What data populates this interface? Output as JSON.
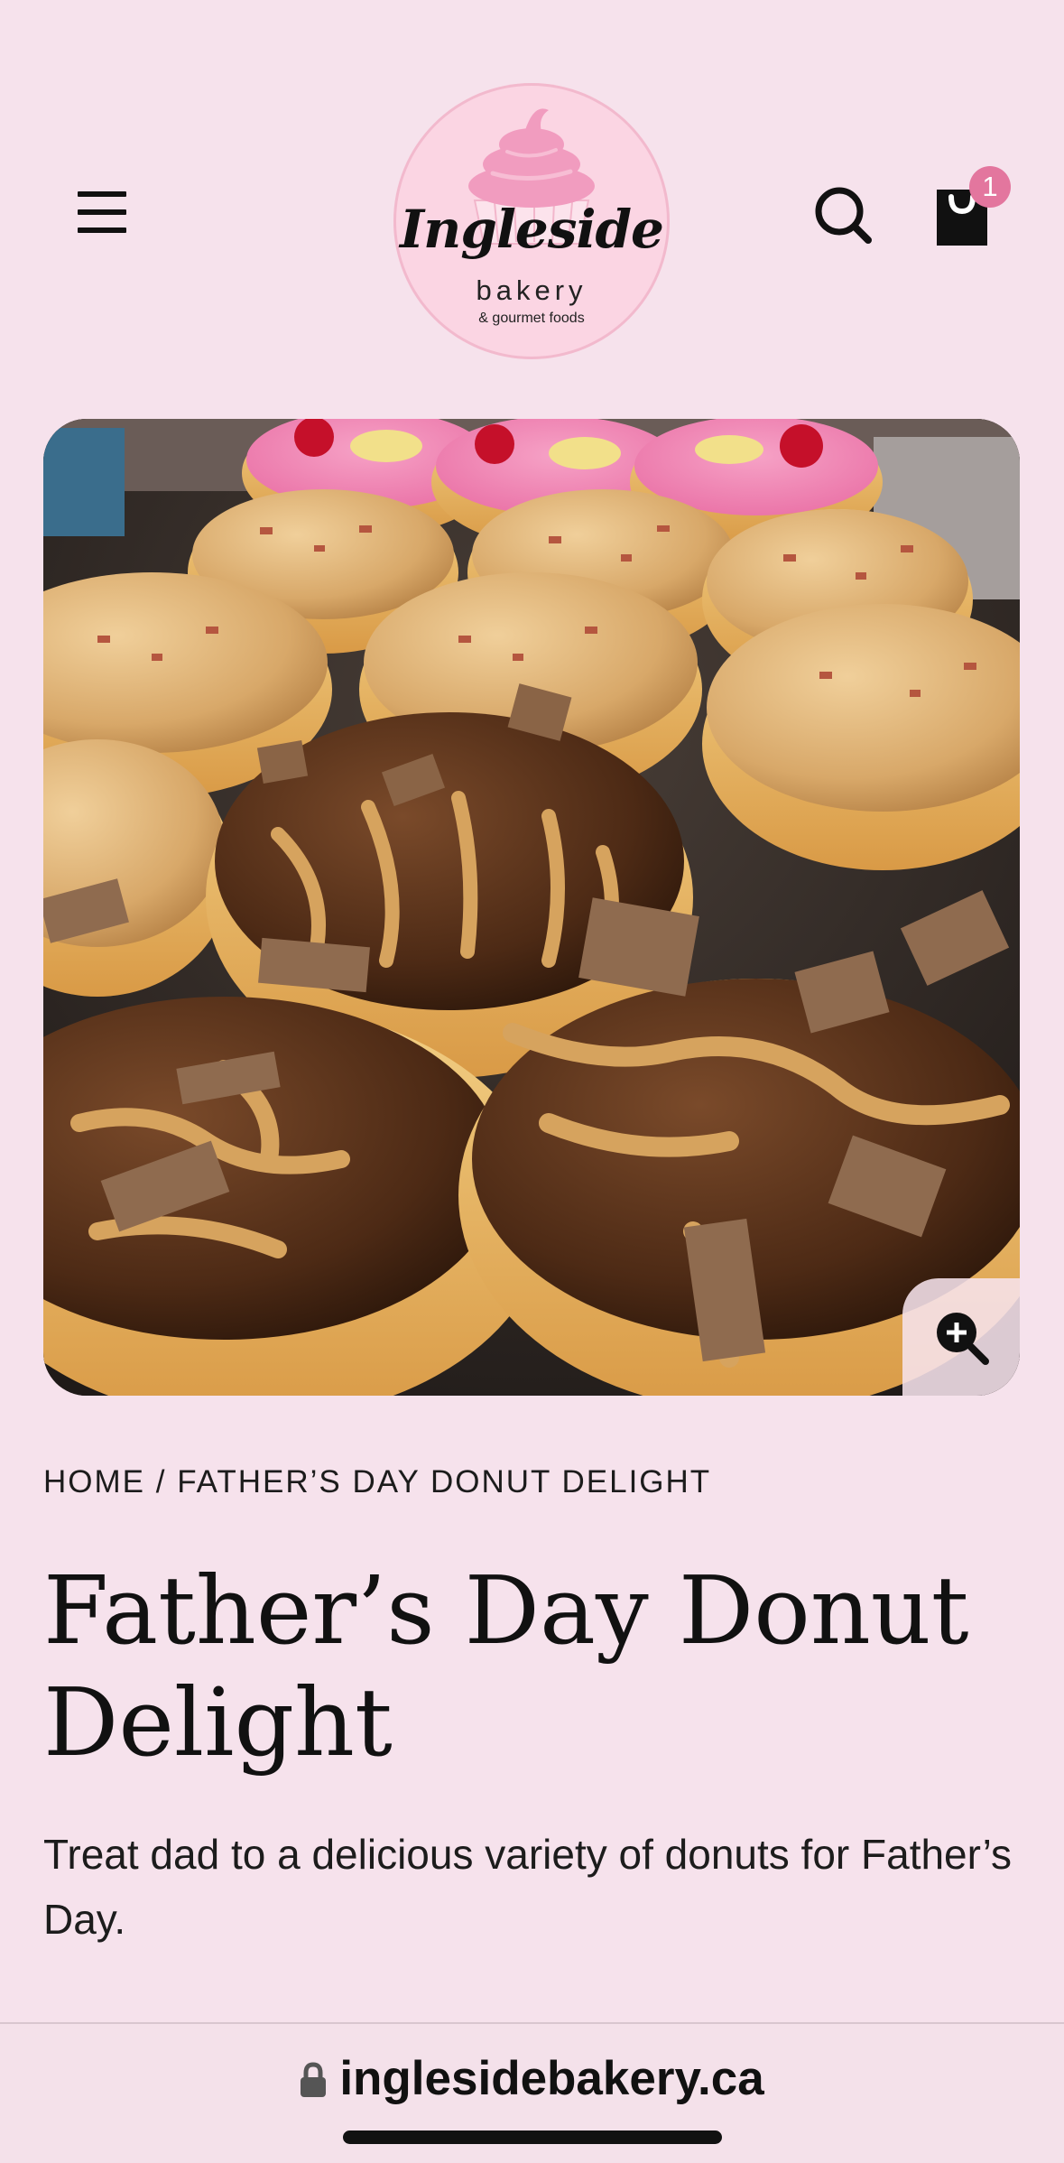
{
  "header": {
    "menu_icon": "hamburger-menu-icon",
    "logo": {
      "script_text": "Ingleside",
      "word_text": "bakery",
      "sub_text": "& gourmet foods"
    },
    "search_icon": "search-icon",
    "cart_icon": "shopping-bag-icon",
    "cart_count": "1",
    "colors": {
      "page_background": "#f6e2ec",
      "logo_circle": "#fbd5e3",
      "cupcake_frosting": "#f19cbf",
      "cart_badge": "#e3769e"
    }
  },
  "product": {
    "image_alt": "Father's Day donuts",
    "zoom_icon": "zoom-in-icon",
    "breadcrumb": {
      "home": "HOME",
      "separator": " / ",
      "current": "FATHER’S DAY DONUT DELIGHT"
    },
    "title": "Father’s Day Donut Delight",
    "description": "Treat dad to a delicious variety of donuts for Father’s Day."
  },
  "browser": {
    "lock_icon": "lock-icon",
    "url": "inglesidebakery.ca"
  }
}
